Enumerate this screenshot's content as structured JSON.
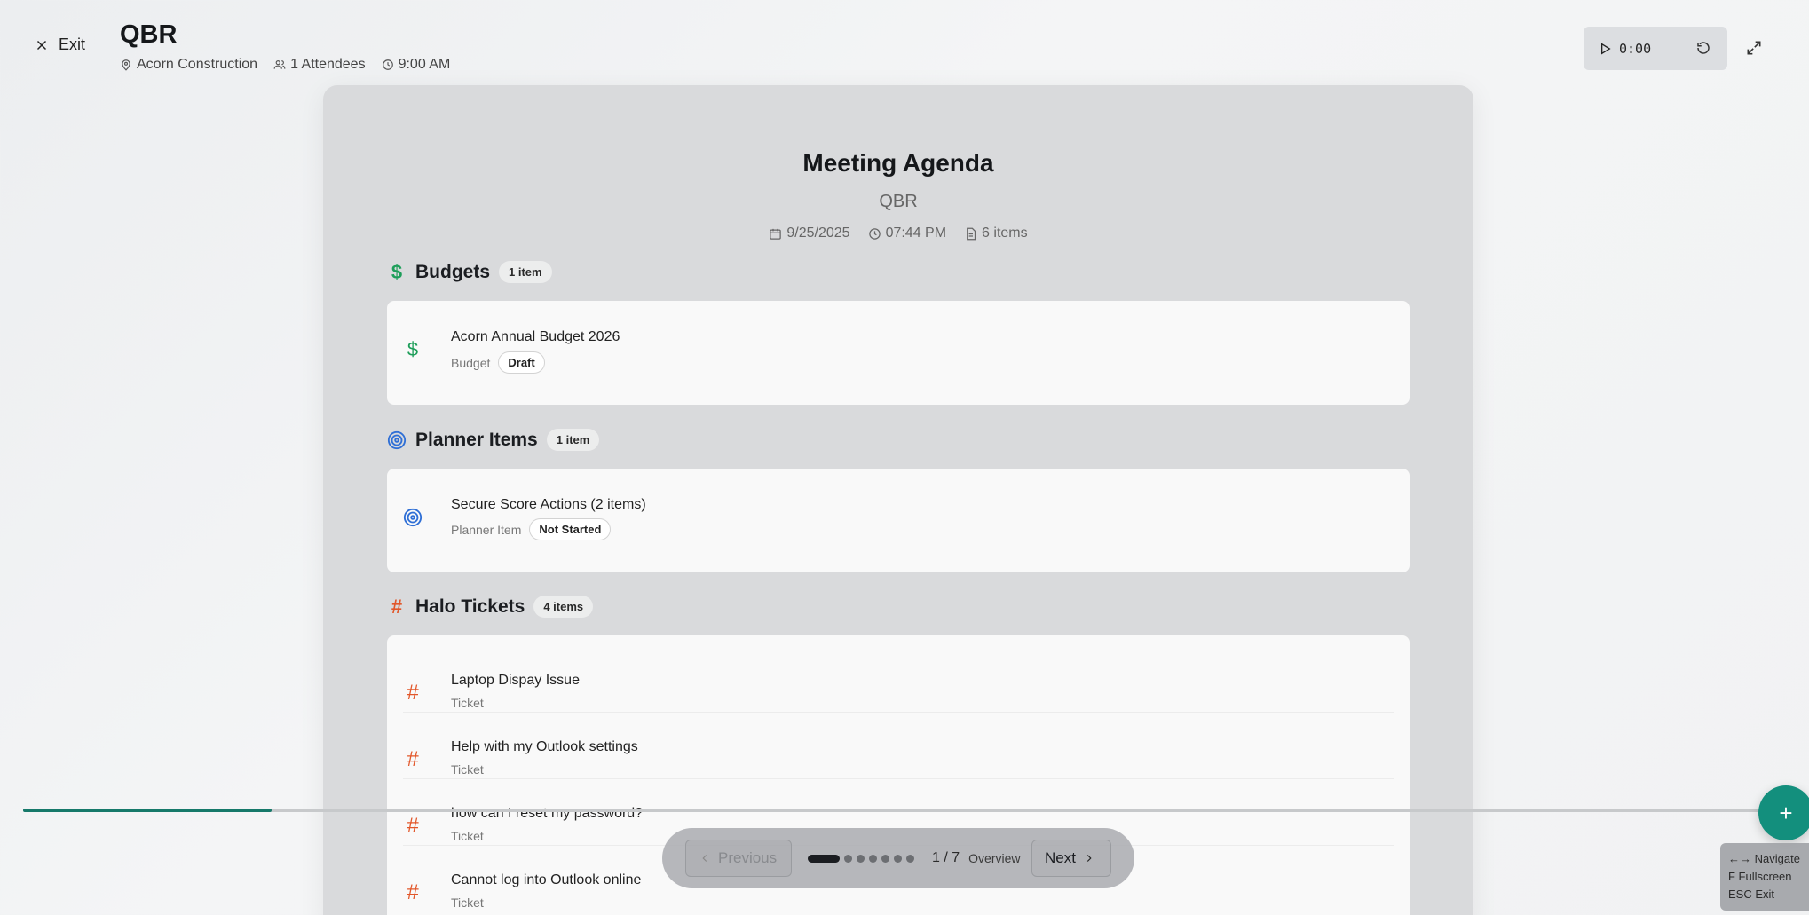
{
  "header": {
    "exit_label": "Exit",
    "title": "QBR",
    "location": "Acorn Construction",
    "attendees": "1 Attendees",
    "time": "9:00 AM"
  },
  "timer": {
    "value": "0:00"
  },
  "agenda": {
    "title": "Meeting Agenda",
    "subtitle": "QBR",
    "date": "9/25/2025",
    "time": "07:44 PM",
    "items_count": "6 items"
  },
  "sections": {
    "budgets": {
      "title": "Budgets",
      "count": "1 item",
      "items": [
        {
          "name": "Acorn Annual Budget 2026",
          "type": "Budget",
          "status": "Draft"
        }
      ]
    },
    "planner": {
      "title": "Planner Items",
      "count": "1 item",
      "items": [
        {
          "name": "Secure Score Actions (2 items)",
          "type": "Planner Item",
          "status": "Not Started"
        }
      ]
    },
    "halo": {
      "title": "Halo Tickets",
      "count": "4 items",
      "items": [
        {
          "name": "Laptop Dispay Issue",
          "type": "Ticket"
        },
        {
          "name": "Help with my Outlook settings",
          "type": "Ticket"
        },
        {
          "name": "how can I reset my password?",
          "type": "Ticket"
        },
        {
          "name": "Cannot log into Outlook online",
          "type": "Ticket"
        }
      ]
    }
  },
  "progress": {
    "fraction": 0.1428
  },
  "navigation": {
    "previous_label": "Previous",
    "next_label": "Next",
    "slide_indicator": "1 / 7",
    "overview_label": "Overview",
    "total_slides": 7,
    "current_slide": 1
  },
  "fab": {
    "label": "+"
  },
  "shortcuts": {
    "navigate": "←→ Navigate",
    "fullscreen": "F Fullscreen",
    "exit": "ESC Exit"
  },
  "colors": {
    "accent": "#138f7d",
    "budget_icon": "#1e9e5a",
    "planner_icon": "#2f6fd6",
    "ticket_icon": "#e2572a"
  }
}
